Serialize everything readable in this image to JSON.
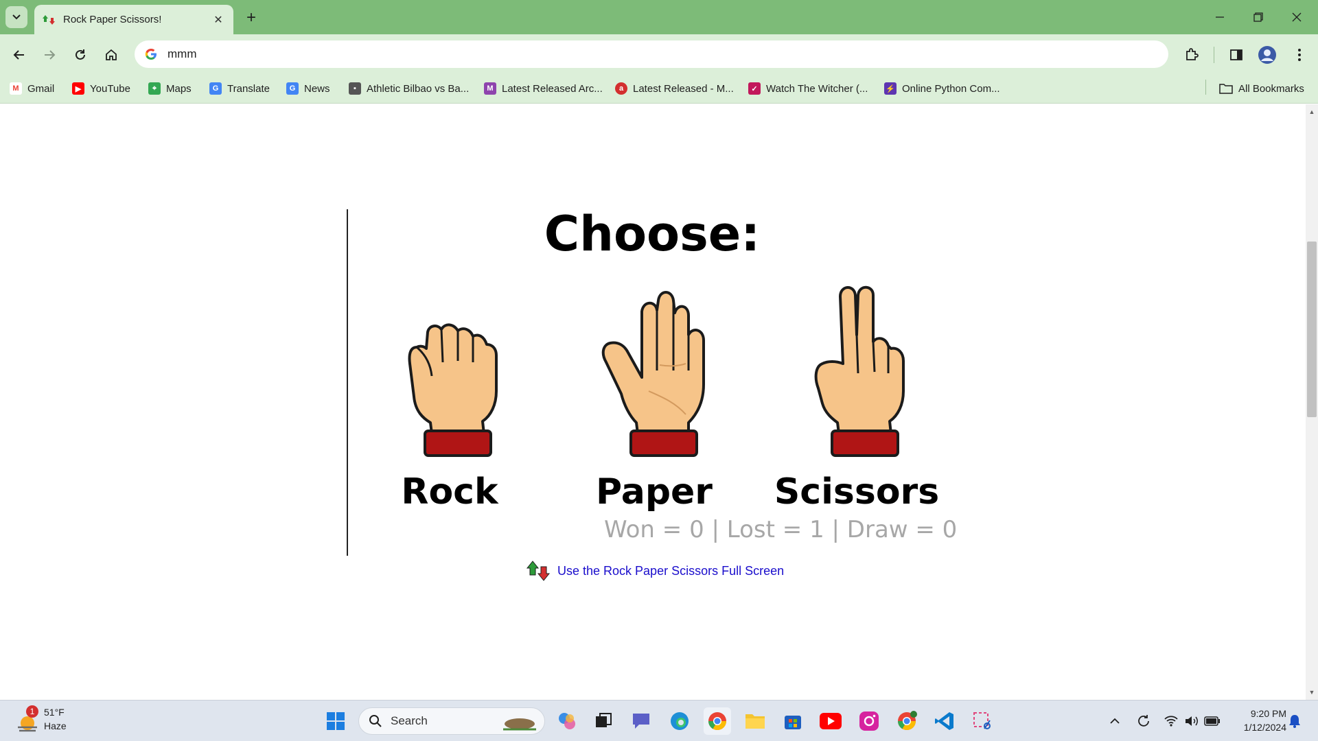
{
  "browser": {
    "tab_title": "Rock Paper Scissors!",
    "address": "mmm",
    "bookmarks": [
      {
        "label": "Gmail",
        "icon": "gmail-icon",
        "color": "#ea4335"
      },
      {
        "label": "YouTube",
        "icon": "youtube-icon",
        "color": "#ff0000"
      },
      {
        "label": "Maps",
        "icon": "maps-icon",
        "color": "#34a853"
      },
      {
        "label": "Translate",
        "icon": "translate-icon",
        "color": "#4285f4"
      },
      {
        "label": "News",
        "icon": "news-icon",
        "color": "#4285f4"
      },
      {
        "label": "Athletic Bilbao vs Ba...",
        "icon": "site-icon",
        "color": "#555555"
      },
      {
        "label": "Latest Released Arc...",
        "icon": "site-icon",
        "color": "#8e44ad"
      },
      {
        "label": "Latest Released - M...",
        "icon": "site-icon",
        "color": "#d32f2f"
      },
      {
        "label": "Watch The Witcher (...",
        "icon": "site-icon",
        "color": "#c2185b"
      },
      {
        "label": "Online Python Com...",
        "icon": "site-icon",
        "color": "#5e35b1"
      }
    ],
    "all_bookmarks": "All Bookmarks"
  },
  "game": {
    "heading": "Choose:",
    "choices": [
      "Rock",
      "Paper",
      "Scissors"
    ],
    "score": "Won = 0 | Lost = 1 | Draw = 0",
    "fullscreen_link": "Use the Rock Paper Scissors Full Screen"
  },
  "taskbar": {
    "weather_temp": "51°F",
    "weather_desc": "Haze",
    "weather_badge": "1",
    "search_placeholder": "Search",
    "time": "9:20 PM",
    "date": "1/12/2024"
  },
  "colors": {
    "chrome_frame": "#7dbb78",
    "chrome_toolbar": "#dcefd9",
    "skin": "#f6c489",
    "cuff": "#b01515",
    "link": "#1a0dcc",
    "score": "#a7a7a7"
  }
}
